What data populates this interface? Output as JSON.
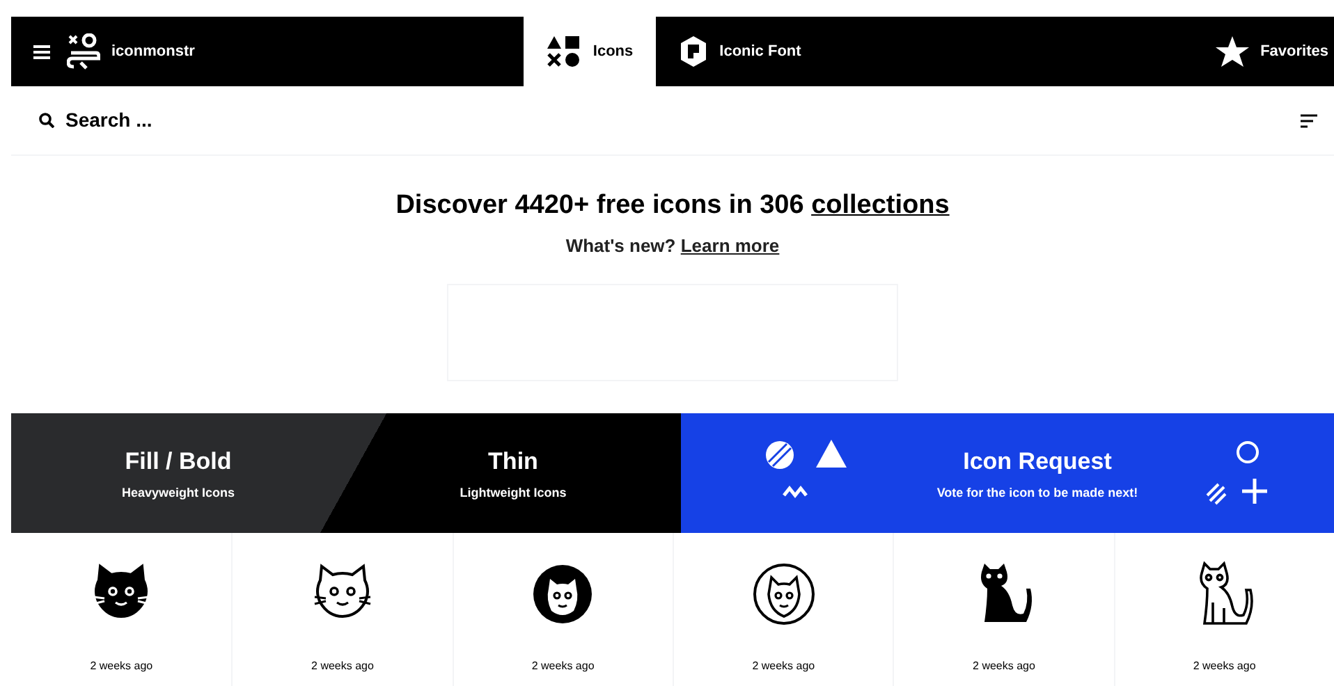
{
  "header": {
    "brand": "iconmonstr",
    "tabs": [
      {
        "label": "Icons",
        "kind": "shapes",
        "selected": true
      },
      {
        "label": "Iconic Font",
        "kind": "font",
        "selected": false
      }
    ],
    "favorites": "Favorites"
  },
  "search": {
    "placeholder": "Search ..."
  },
  "hero": {
    "title": "Discover 4420+ free icons in 306 ",
    "title_link": "collections",
    "subtitle": "What's new? ",
    "subtitle_link": "Learn more"
  },
  "banners": [
    {
      "title": "Fill / Bold",
      "subtitle": "Heavyweight Icons"
    },
    {
      "title": "Thin",
      "subtitle": "Lightweight Icons"
    },
    {
      "title": "Icon Request",
      "subtitle": "Vote for the icon to be made next!"
    }
  ],
  "icons": [
    {
      "kind": "face-fill",
      "time": "2 weeks ago"
    },
    {
      "kind": "face-outline",
      "time": "2 weeks ago"
    },
    {
      "kind": "circle-fill",
      "time": "2 weeks ago"
    },
    {
      "kind": "circle-outline",
      "time": "2 weeks ago"
    },
    {
      "kind": "sitting-fill",
      "time": "2 weeks ago"
    },
    {
      "kind": "sitting-outline",
      "time": "2 weeks ago"
    }
  ]
}
